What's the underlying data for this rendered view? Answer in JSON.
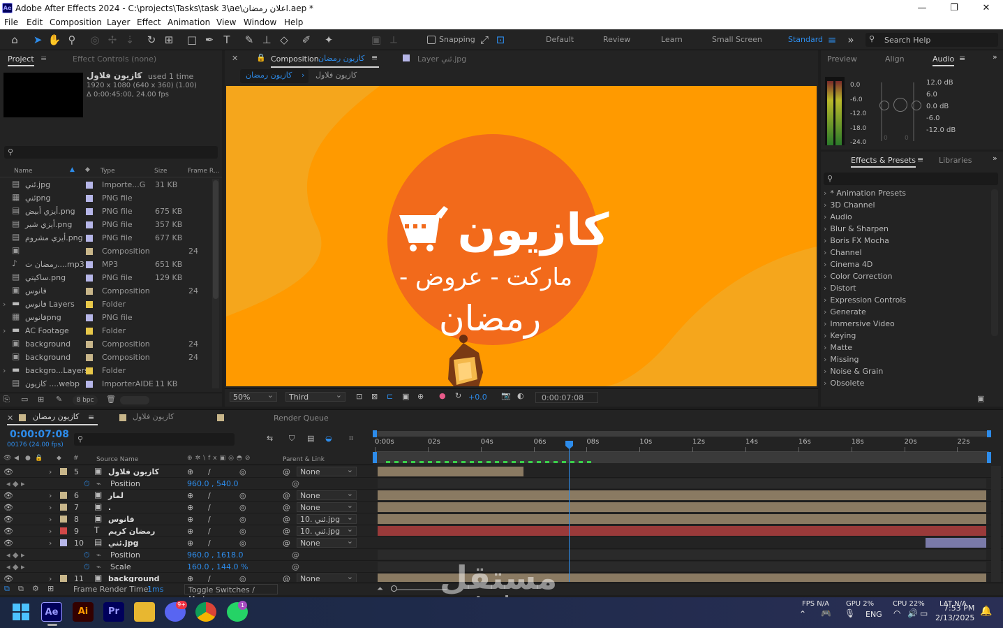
{
  "window": {
    "title": "Adobe After Effects 2024 - C:\\projects\\Tasks\\task 3\\ae\\اعلان رمضان.aep *",
    "logo": "Ae",
    "minimize": "—",
    "maximize": "❐",
    "close": "✕"
  },
  "menu": [
    "File",
    "Edit",
    "Composition",
    "Layer",
    "Effect",
    "Animation",
    "View",
    "Window",
    "Help"
  ],
  "toolbar": {
    "snapping": "Snapping",
    "workspaces": [
      "Default",
      "Review",
      "Learn",
      "Small Screen",
      "Standard"
    ],
    "search_placeholder": "Search Help"
  },
  "project": {
    "tab": "Project",
    "tab2": "Effect Controls (none)",
    "selected_name": "كازيون فلاول",
    "used": "used 1 time",
    "resolution": "1920 x 1080  (640 x 360) (1.00)",
    "duration": "Δ 0:00:45:00, 24.00 fps",
    "columns": [
      "Name",
      "Type",
      "Size",
      "Frame R..."
    ],
    "items": [
      {
        "name": "ئني.jpg",
        "type": "Importe...G",
        "size": "31 KB",
        "frame": "",
        "label": "#b6b6e8",
        "icon": "file"
      },
      {
        "name": "ئنيpng",
        "type": "PNG file",
        "size": "",
        "frame": "",
        "label": "#b6b6e8",
        "icon": "img"
      },
      {
        "name": "أيزي أبيض.png",
        "type": "PNG file",
        "size": "675 KB",
        "frame": "",
        "label": "#b6b6e8",
        "icon": "file"
      },
      {
        "name": "أيزي شير.png",
        "type": "PNG file",
        "size": "357 KB",
        "frame": "",
        "label": "#b6b6e8",
        "icon": "file"
      },
      {
        "name": "أيزي مشروم.png",
        "type": "PNG file",
        "size": "677 KB",
        "frame": "",
        "label": "#b6b6e8",
        "icon": "file"
      },
      {
        "name": "",
        "type": "Composition",
        "size": "",
        "frame": "24",
        "label": "#c8b68a",
        "icon": "comp"
      },
      {
        "name": "رمضان ت....mp3",
        "type": "MP3",
        "size": "651 KB",
        "frame": "",
        "label": "#b6b6e8",
        "icon": "audio"
      },
      {
        "name": "ساكيتي.png",
        "type": "PNG file",
        "size": "129 KB",
        "frame": "",
        "label": "#b6b6e8",
        "icon": "file"
      },
      {
        "name": "فانوس",
        "type": "Composition",
        "size": "",
        "frame": "24",
        "label": "#c8b68a",
        "icon": "comp"
      },
      {
        "name": "فانوس Layers",
        "type": "Folder",
        "size": "",
        "frame": "",
        "label": "#e8c84a",
        "icon": "folder"
      },
      {
        "name": "فانوسpng",
        "type": "PNG file",
        "size": "",
        "frame": "",
        "label": "#b6b6e8",
        "icon": "img"
      },
      {
        "name": "AC Footage",
        "type": "Folder",
        "size": "",
        "frame": "",
        "label": "#e8c84a",
        "icon": "folder"
      },
      {
        "name": "background",
        "type": "Composition",
        "size": "",
        "frame": "24",
        "label": "#c8b68a",
        "icon": "comp"
      },
      {
        "name": "background",
        "type": "Composition",
        "size": "",
        "frame": "24",
        "label": "#c8b68a",
        "icon": "comp"
      },
      {
        "name": "backgro...Layers",
        "type": "Folder",
        "size": "",
        "frame": "",
        "label": "#e8c84a",
        "icon": "folder"
      },
      {
        "name": "كازيون ....webp",
        "type": "ImporterAIDE",
        "size": "11 KB",
        "frame": "",
        "label": "#b6b6e8",
        "icon": "file"
      }
    ],
    "bpc": "8 bpc"
  },
  "composition": {
    "tab_prefix": "Composition",
    "tab_name": "كازيون رمضان",
    "layer_tab": "Layer ئني.jpg",
    "breadcrumb": [
      "كازيون رمضان",
      "كازيون فلاول"
    ],
    "title": "كازيون",
    "subtitle": "- ماركت - عروض",
    "tagline": "رمضان",
    "zoom": "50%",
    "resolution": "Third",
    "exposure": "+0.0",
    "timecode": "0:00:07:08",
    "colors": {
      "bg": "#ff9a00",
      "bg_shape": "#f5a61c",
      "circle": "#f26a1b",
      "text": "#ffffff"
    }
  },
  "audio": {
    "tabs": [
      "Preview",
      "Align",
      "Audio"
    ],
    "left_scale": [
      "0.0",
      "-6.0",
      "-12.0",
      "-18.0",
      "-24.0"
    ],
    "right_scale": [
      "12.0 dB",
      "6.0",
      "0.0 dB",
      "-6.0",
      "-12.0 dB"
    ],
    "knob_zero_left": "0",
    "knob_zero_right": "0"
  },
  "effects": {
    "tabs": [
      "Effects & Presets",
      "Libraries"
    ],
    "items": [
      "* Animation Presets",
      "3D Channel",
      "Audio",
      "Blur & Sharpen",
      "Boris FX Mocha",
      "Channel",
      "Cinema 4D",
      "Color Correction",
      "Distort",
      "Expression Controls",
      "Generate",
      "Immersive Video",
      "Keying",
      "Matte",
      "Missing",
      "Noise & Grain",
      "Obsolete"
    ]
  },
  "timeline": {
    "tabs": [
      "كازيون رمضان",
      "كازيون فلاول",
      "",
      "Render Queue"
    ],
    "timecode": "0:00:07:08",
    "frame_info": "00176 (24.00 fps)",
    "columns": {
      "source": "Source Name",
      "parent": "Parent & Link"
    },
    "ruler": [
      "0:00s",
      "02s",
      "04s",
      "06s",
      "08s",
      "10s",
      "12s",
      "14s",
      "16s",
      "18s",
      "20s",
      "22s"
    ],
    "playhead_seconds": 7.33,
    "layers": [
      {
        "num": "5",
        "name": "كازيون فلاول",
        "label": "#c8b68a",
        "icon": "comp",
        "parent": "None",
        "bar_color": "#8a7a62",
        "bar_start": 0,
        "bar_end": 0.24
      },
      {
        "num": "",
        "name": "Position",
        "prop": true,
        "value": "960.0 , 540.0"
      },
      {
        "num": "6",
        "name": "لمار",
        "label": "#c8b68a",
        "icon": "comp",
        "parent": "None",
        "bar_color": "#8a7a62",
        "bar_start": 0,
        "bar_end": 1
      },
      {
        "num": "7",
        "name": ".",
        "label": "#c8b68a",
        "icon": "comp",
        "parent": "None",
        "bar_color": "#8a7a62",
        "bar_start": 0,
        "bar_end": 1
      },
      {
        "num": "8",
        "name": "فانوس",
        "label": "#c8b68a",
        "icon": "comp",
        "parent": "10. ئني.jpg",
        "bar_color": "#8a7a62",
        "bar_start": 0,
        "bar_end": 1
      },
      {
        "num": "9",
        "name": "رمضان كريم",
        "label": "#d14848",
        "icon": "text",
        "parent": "10. ئني.jpg",
        "bar_color": "#9a3a3a",
        "bar_start": 0,
        "bar_end": 1
      },
      {
        "num": "10",
        "name": "ئني.jpg",
        "label": "#b6b6e8",
        "icon": "file",
        "parent": "None",
        "bar_color": "#7a7aa8",
        "bar_start": 0.9,
        "bar_end": 1
      },
      {
        "num": "",
        "name": "Position",
        "prop": true,
        "value": "960.0 , 1618.0"
      },
      {
        "num": "",
        "name": "Scale",
        "prop": true,
        "value": "160.0 , 144.0 %"
      },
      {
        "num": "11",
        "name": "background",
        "label": "#c8b68a",
        "icon": "comp",
        "parent": "None",
        "bar_color": "#8a7a62",
        "bar_start": 0,
        "bar_end": 1
      }
    ],
    "footer": {
      "render_label": "Frame Render Time:",
      "render_value": "1ms",
      "toggle": "Toggle Switches / Modes"
    }
  },
  "taskbar": {
    "apps": [
      "Ae",
      "Ai",
      "Pr",
      "",
      "",
      "",
      "",
      ""
    ],
    "discord_badge": "9+",
    "whatsapp_badge": "1",
    "fps": "FPS N/A",
    "gpu": "GPU 2%",
    "cpu": "CPU 22%",
    "lat": "LAT N/A",
    "lang": "ENG",
    "time": "7:53 PM",
    "date": "2/13/2025"
  },
  "watermark": {
    "arabic": "مستقل",
    "latin": "mostaql.com"
  }
}
